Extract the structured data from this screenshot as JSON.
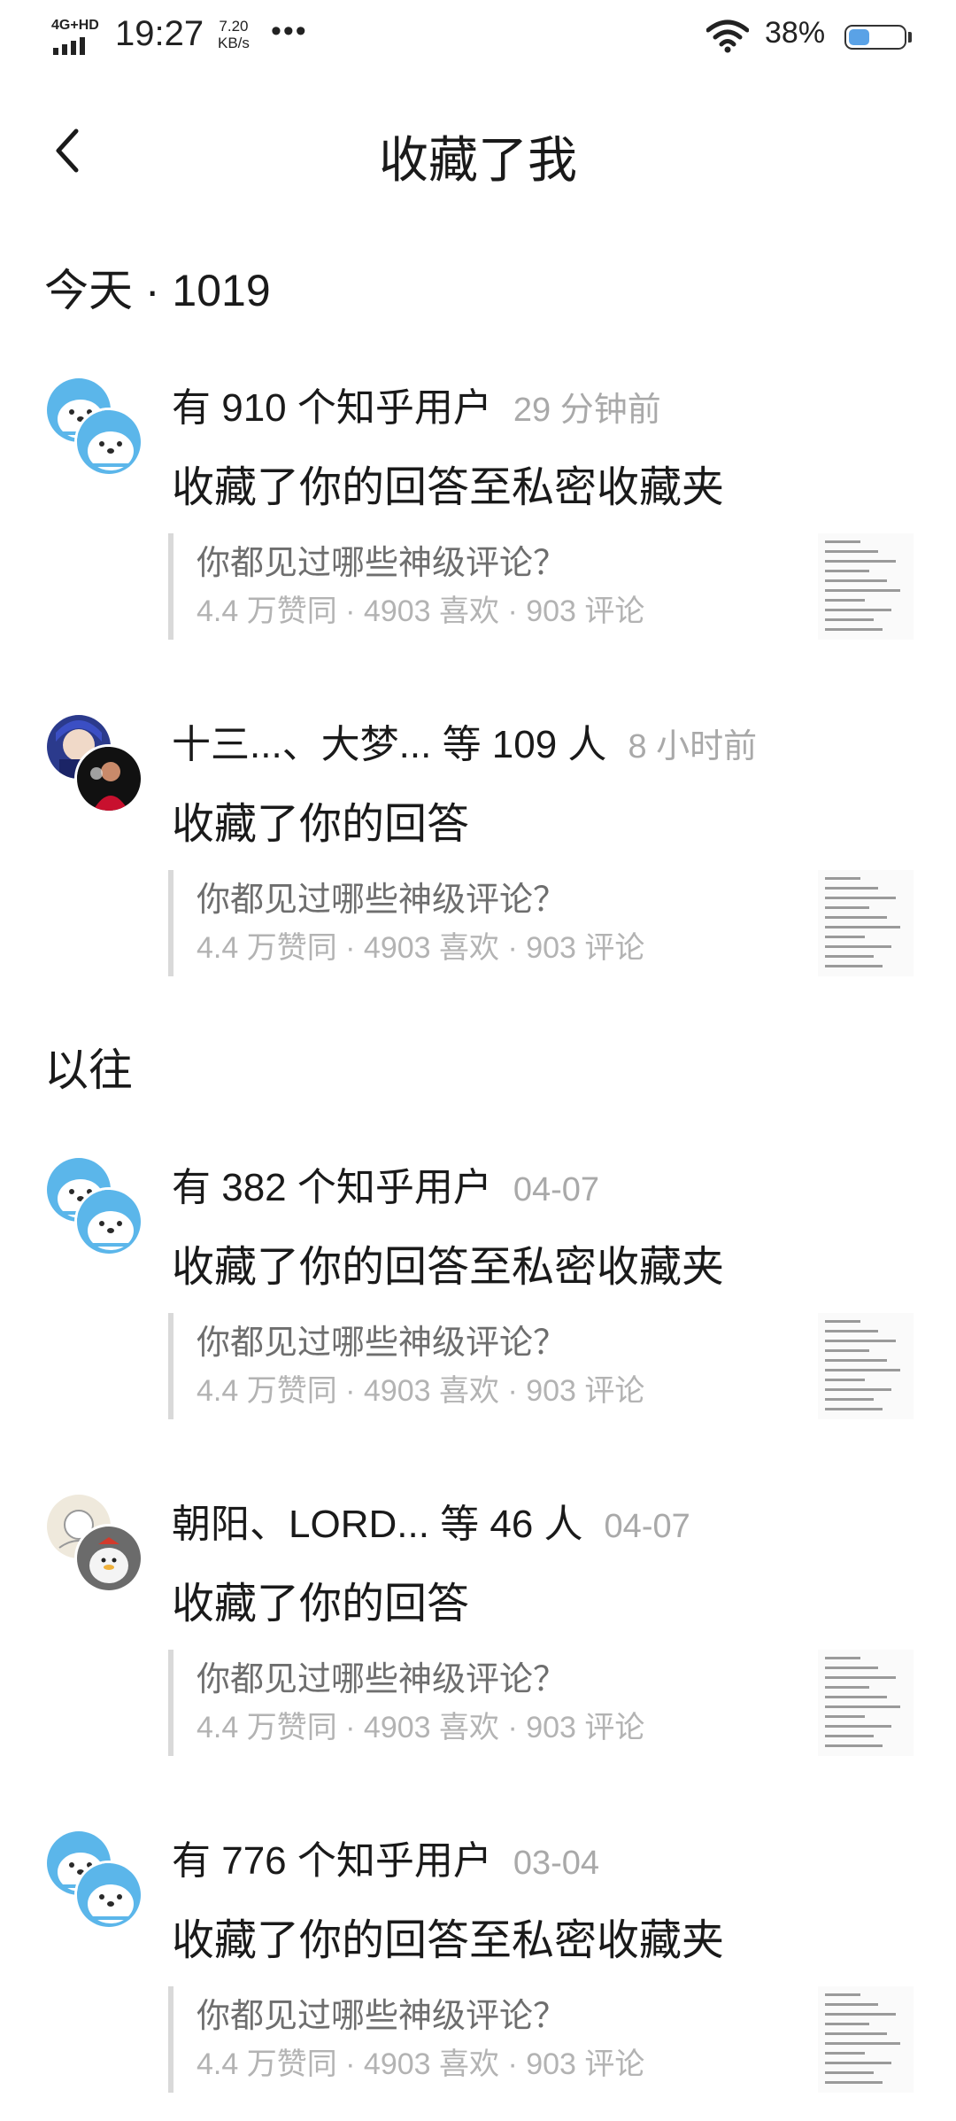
{
  "status_bar": {
    "network": "4G+HD",
    "time": "19:27",
    "speed_value": "7.20",
    "speed_unit": "KB/s",
    "more": "•••",
    "battery_pct": "38%",
    "battery_level": 0.38
  },
  "header": {
    "title": "收藏了我"
  },
  "sections": {
    "today": "今天 · 1019",
    "past": "以往"
  },
  "items": [
    {
      "actors": "有 910 个知乎用户",
      "time": "29 分钟前",
      "action": "收藏了你的回答至私密收藏夹",
      "question": "你都见过哪些神级评论？",
      "meta": "4.4 万赞同 · 4903 喜欢 · 903 评论",
      "avatars": [
        "default-avatar-icon",
        "default-avatar-icon"
      ]
    },
    {
      "actors": "十三...、大梦... 等 109 人",
      "time": "8 小时前",
      "action": "收藏了你的回答",
      "question": "你都见过哪些神级评论？",
      "meta": "4.4 万赞同 · 4903 喜欢 · 903 评论",
      "avatars": [
        "anime-avatar",
        "photo-avatar"
      ]
    },
    {
      "actors": "有 382 个知乎用户",
      "time": "04-07",
      "action": "收藏了你的回答至私密收藏夹",
      "question": "你都见过哪些神级评论？",
      "meta": "4.4 万赞同 · 4903 喜欢 · 903 评论",
      "avatars": [
        "default-avatar-icon",
        "default-avatar-icon"
      ]
    },
    {
      "actors": "朝阳、LORD... 等 46 人",
      "time": "04-07",
      "action": "收藏了你的回答",
      "question": "你都见过哪些神级评论？",
      "meta": "4.4 万赞同 · 4903 喜欢 · 903 评论",
      "avatars": [
        "sketch-avatar",
        "duck-avatar"
      ]
    },
    {
      "actors": "有 776 个知乎用户",
      "time": "03-04",
      "action": "收藏了你的回答至私密收藏夹",
      "question": "你都见过哪些神级评论？",
      "meta": "4.4 万赞同 · 4903 喜欢 · 903 评论",
      "avatars": [
        "default-avatar-icon",
        "default-avatar-icon"
      ]
    }
  ],
  "colors": {
    "text": "#1a1a1a",
    "secondary": "#a9a9a9",
    "quote_bar": "#d9d9d9",
    "avatar_blue": "#5bb6ea",
    "battery": "#5aa2e6"
  }
}
